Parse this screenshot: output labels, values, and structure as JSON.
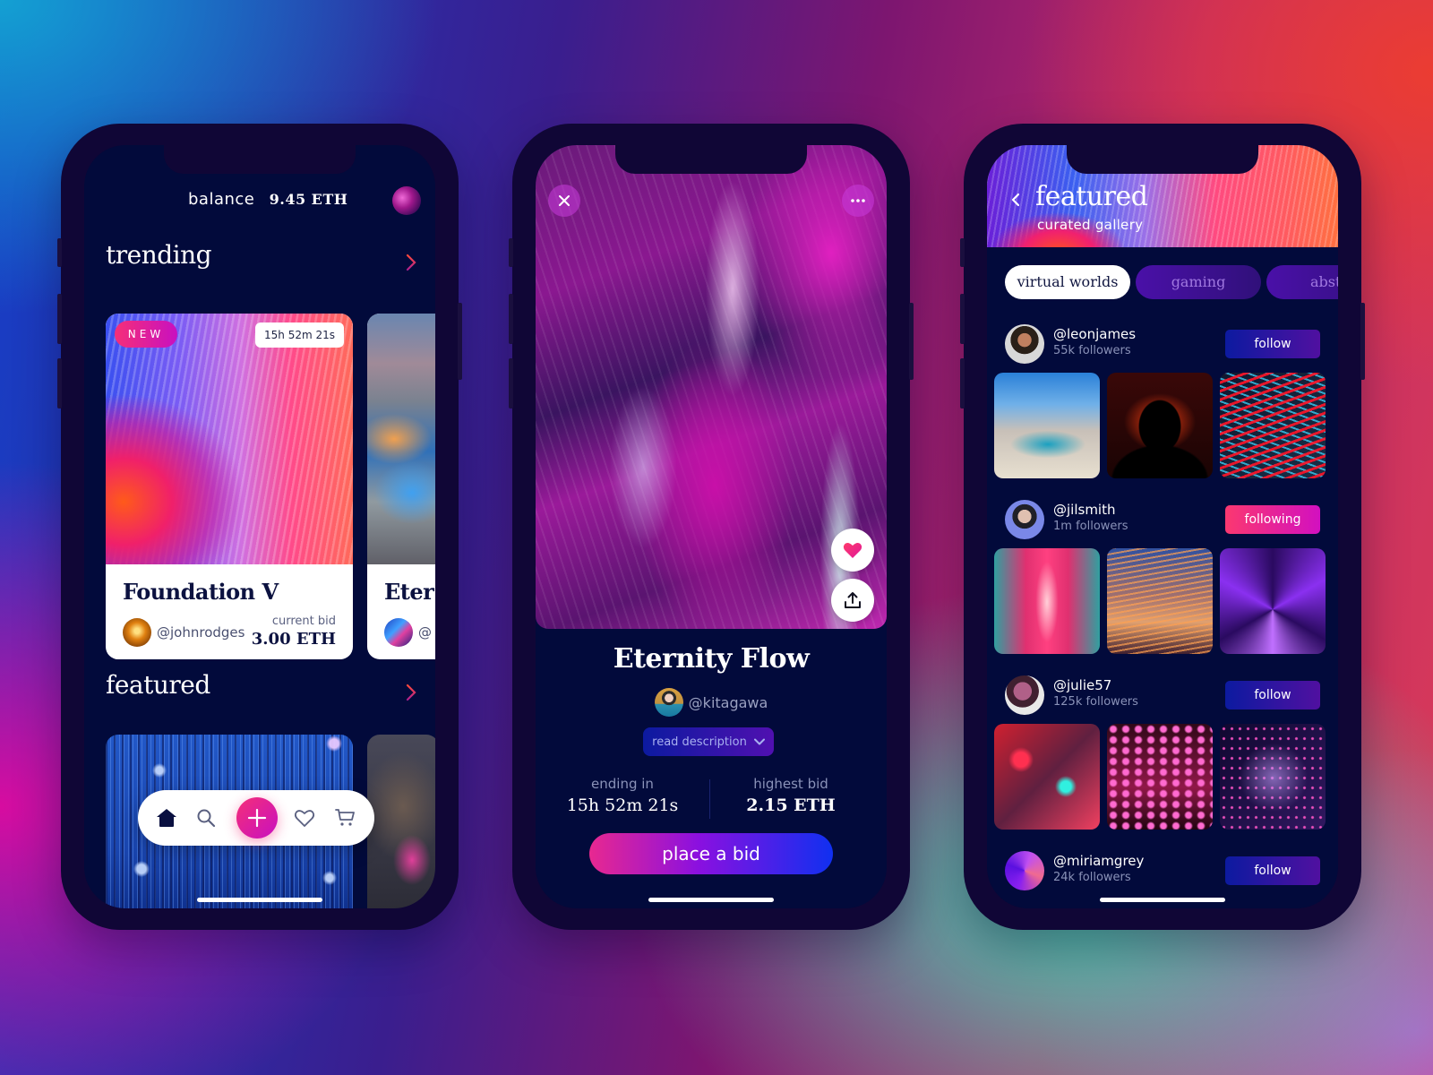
{
  "phone1": {
    "balance_label": "balance",
    "balance_value": "9.45 ETH",
    "trending_title": "trending",
    "featured_title": "featured",
    "trending_cards": [
      {
        "badge": "NEW",
        "time_left": "15h 52m 21s",
        "title": "Foundation V",
        "creator": "@johnrodges",
        "bid_label": "current bid",
        "bid_value": "3.00 ETH"
      },
      {
        "title": "Eter",
        "creator": "@"
      }
    ],
    "nav": [
      {
        "icon": "home-icon",
        "active": true
      },
      {
        "icon": "search-icon"
      },
      {
        "icon": "plus-icon"
      },
      {
        "icon": "heart-icon"
      },
      {
        "icon": "cart-icon"
      }
    ]
  },
  "phone2": {
    "title": "Eternity Flow",
    "creator": "@kitagawa",
    "read_description": "read description",
    "ending_label": "ending in",
    "ending_value": "15h 52m 21s",
    "highest_label": "highest bid",
    "highest_value": "2.15 ETH",
    "cta": "place a bid"
  },
  "phone3": {
    "title": "featured",
    "subtitle": "curated gallery",
    "tabs": [
      "virtual worlds",
      "gaming",
      "abstr"
    ],
    "active_tab": "virtual worlds",
    "creators": [
      {
        "handle": "@leonjames",
        "followers": "55k followers",
        "button": "follow",
        "state": "follow"
      },
      {
        "handle": "@jilsmith",
        "followers": "1m followers",
        "button": "following",
        "state": "following"
      },
      {
        "handle": "@julie57",
        "followers": "125k followers",
        "button": "follow",
        "state": "follow"
      },
      {
        "handle": "@miriamgrey",
        "followers": "24k followers",
        "button": "follow",
        "state": "follow"
      }
    ]
  },
  "colors": {
    "screen_bg": "#020a3b",
    "accent_pink": "#f52f78",
    "accent_magenta": "#c810c0",
    "accent_blue": "#1030f0",
    "follow_blue": "#0c1aa0"
  }
}
